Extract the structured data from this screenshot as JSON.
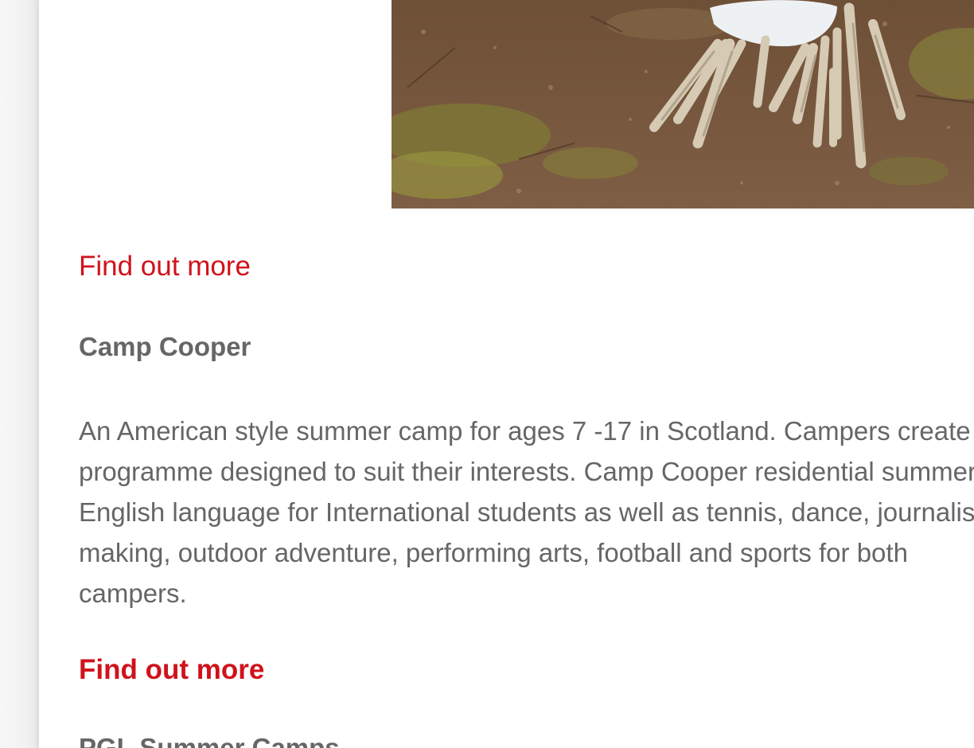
{
  "hero_image": {
    "icon": "campfire-sticks-photo",
    "colors": {
      "ground": "#7a5a3f",
      "moss": "#8c8a3a",
      "sticks": "#d8ccb8",
      "cloth": "#f2f4f6"
    }
  },
  "links": {
    "find_out_more_1": "Find out more",
    "find_out_more_2": "Find out more"
  },
  "camp": {
    "title": "Camp Cooper",
    "description_lines": [
      "An American style summer camp for ages 7 -17 in Scotland.  Campers create",
      "programme designed to suit their interests. Camp Cooper residential summer",
      "English language for International students as well as  tennis, dance, journalism,",
      "making, outdoor adventure, performing arts, football and sports for both",
      "campers."
    ]
  },
  "next_section": {
    "title": "PGL Summer Camps"
  },
  "colors": {
    "link": "#d0121b",
    "text": "#666666",
    "background": "#ffffff"
  }
}
